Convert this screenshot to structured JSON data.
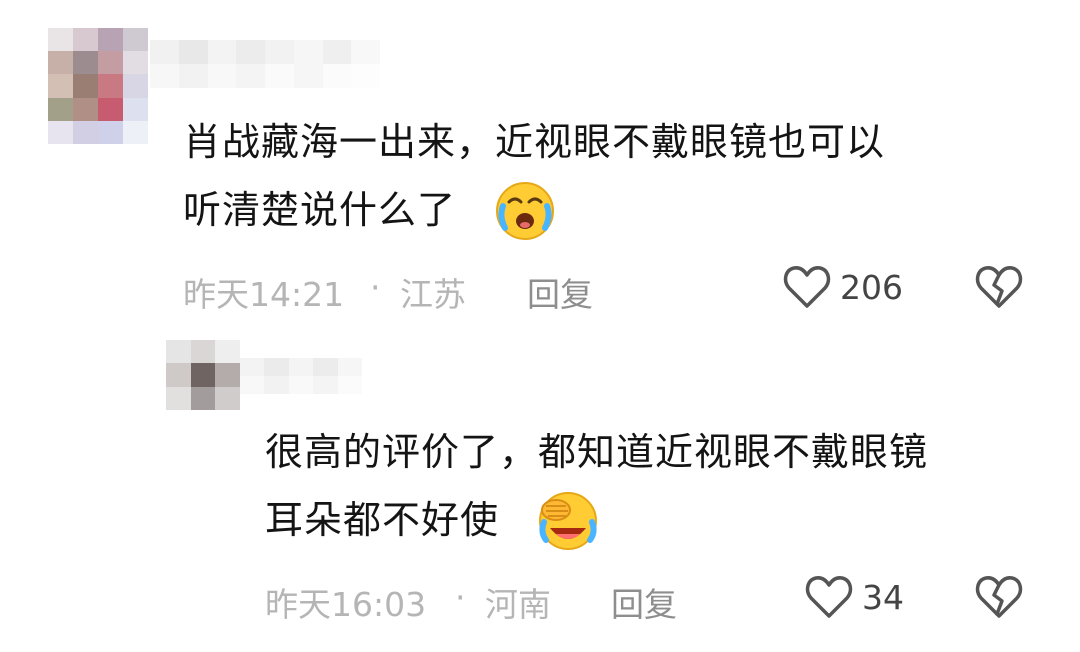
{
  "comments": [
    {
      "text_line1": "肖战藏海一出来，近视眼不戴眼镜也可以",
      "text_line2": "听清楚说什么了",
      "time": "昨天14:21",
      "separator": "·",
      "location": "江苏",
      "reply_label": "回复",
      "likes": "206",
      "emoji": "crying-laughing-emoji"
    },
    {
      "text_line1": "很高的评价了，都知道近视眼不戴眼镜",
      "text_line2": "耳朵都不好使",
      "time": "昨天16:03",
      "separator": "·",
      "location": "河南",
      "reply_label": "回复",
      "likes": "34",
      "emoji": "laughing-hand-emoji"
    }
  ],
  "icons": {
    "like": "heart-outline-icon",
    "dislike": "broken-heart-icon"
  },
  "colors": {
    "text": "#141414",
    "meta": "#b5b5b5",
    "reply": "#8e8e8e",
    "icon": "#555555"
  }
}
